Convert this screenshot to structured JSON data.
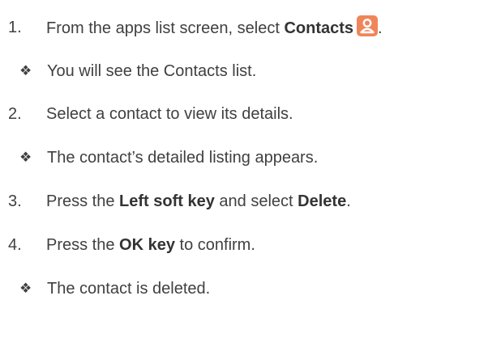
{
  "steps": [
    {
      "number": "1.",
      "text_before": "From the apps list screen, select ",
      "bold": "Contacts",
      "icon": "contacts-app-icon",
      "text_after": ".",
      "note": "You will see the Contacts list."
    },
    {
      "number": "2.",
      "text": "Select a contact to view its details.",
      "note": "The contact’s detailed listing appears."
    },
    {
      "number": "3.",
      "text_before": "Press the ",
      "bold1": "Left soft key",
      "text_middle": " and select ",
      "bold2": "Delete",
      "text_after": "."
    },
    {
      "number": "4.",
      "text_before": "Press the ",
      "bold": "OK key",
      "text_after": " to confirm.",
      "note": "The contact is deleted."
    }
  ],
  "bullet_glyph": "❖",
  "colors": {
    "text": "#404040",
    "icon_bg": "#f0855a"
  }
}
